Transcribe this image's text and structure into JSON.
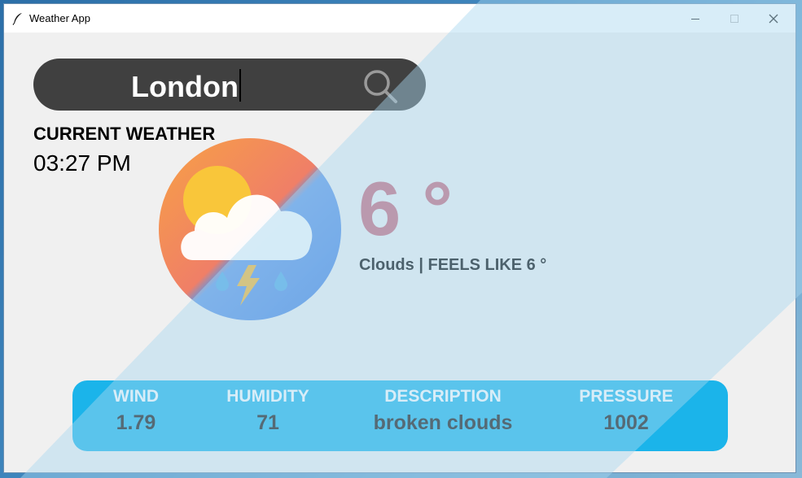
{
  "window": {
    "title": "Weather App",
    "icon": "feather-icon",
    "controls": [
      "minimize-icon",
      "maximize-icon",
      "close-icon"
    ]
  },
  "search": {
    "value": "London",
    "icon": "search-icon"
  },
  "current": {
    "label": "CURRENT WEATHER",
    "time": "03:27 PM",
    "icon": "cloud-sun-storm-icon"
  },
  "temperature": {
    "value": "6 °",
    "color": "#c96678",
    "condition_line": "Clouds | FEELS LIKE 6 °"
  },
  "stats": {
    "wind_label": "WIND",
    "wind_value": "1.79",
    "humidity_label": "HUMIDITY",
    "humidity_value": "71",
    "description_label": "DESCRIPTION",
    "description_value": "broken clouds",
    "pressure_label": "PRESSURE",
    "pressure_value": "1002",
    "panel_color": "#1bb4ea"
  }
}
